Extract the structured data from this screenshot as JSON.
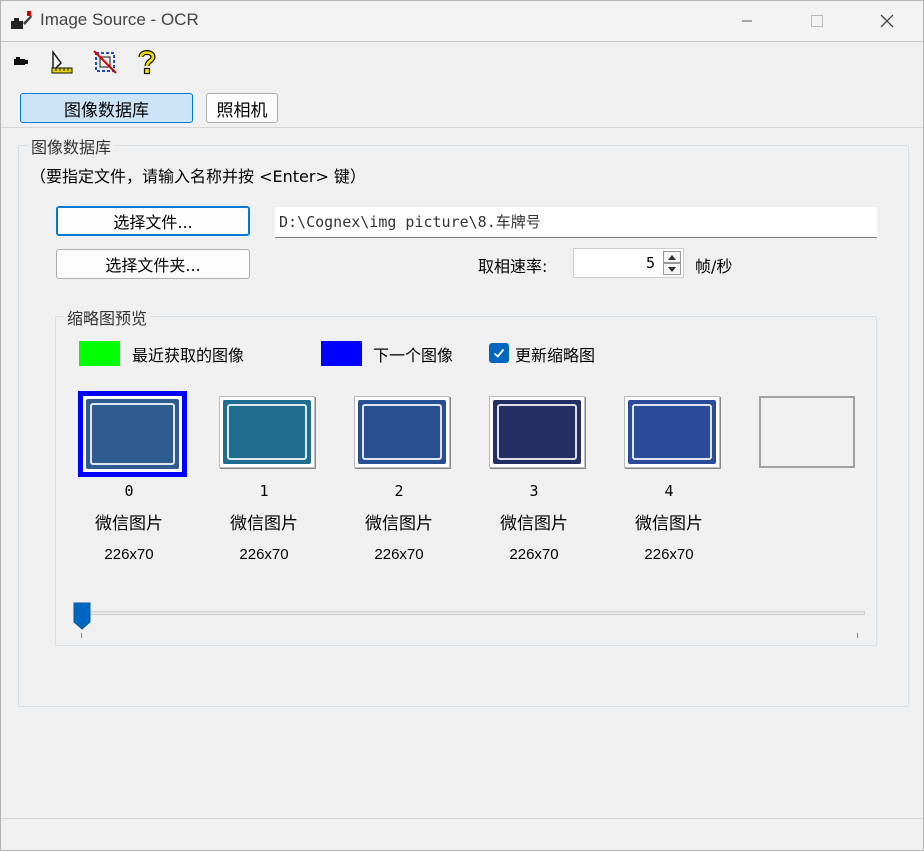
{
  "window": {
    "title": "Image Source - OCR",
    "icon": "camera-app-icon"
  },
  "toolbar": {
    "items": [
      {
        "name": "camera-tool-icon"
      },
      {
        "name": "calibration-tool-icon"
      },
      {
        "name": "roi-tool-icon"
      },
      {
        "name": "help-icon"
      }
    ]
  },
  "tabs": {
    "database_label": "图像数据库",
    "camera_label": "照相机"
  },
  "database_group": {
    "title": "图像数据库",
    "instruction": "（要指定文件，请输入名称并按 <Enter> 键）",
    "select_file_label": "选择文件...",
    "select_folder_label": "选择文件夹...",
    "path_value": "D:\\Cognex\\img picture\\8.车牌号",
    "rate_label": "取相速率:",
    "rate_value": "5",
    "rate_unit": "帧/秒"
  },
  "thumbnail_group": {
    "title": "缩略图预览",
    "legend_recent": "最近获取的图像",
    "legend_next": "下一个图像",
    "update_label": "更新缩略图",
    "update_checked": true,
    "colors": {
      "recent": "#00ff00",
      "next": "#0000ff"
    },
    "thumbnails": [
      {
        "index": "0",
        "name": "微信图片",
        "size": "226x70",
        "plate_icon": "license-plate-image",
        "color": "#2e5c8f"
      },
      {
        "index": "1",
        "name": "微信图片",
        "size": "226x70",
        "plate_icon": "license-plate-image",
        "color": "#1f6e8f"
      },
      {
        "index": "2",
        "name": "微信图片",
        "size": "226x70",
        "plate_icon": "license-plate-image",
        "color": "#274f92"
      },
      {
        "index": "3",
        "name": "微信图片",
        "size": "226x70",
        "plate_icon": "license-plate-image",
        "color": "#242f63"
      },
      {
        "index": "4",
        "name": "微信图片",
        "size": "226x70",
        "plate_icon": "license-plate-image",
        "color": "#2a4a9a"
      }
    ],
    "slider_position": 0
  }
}
